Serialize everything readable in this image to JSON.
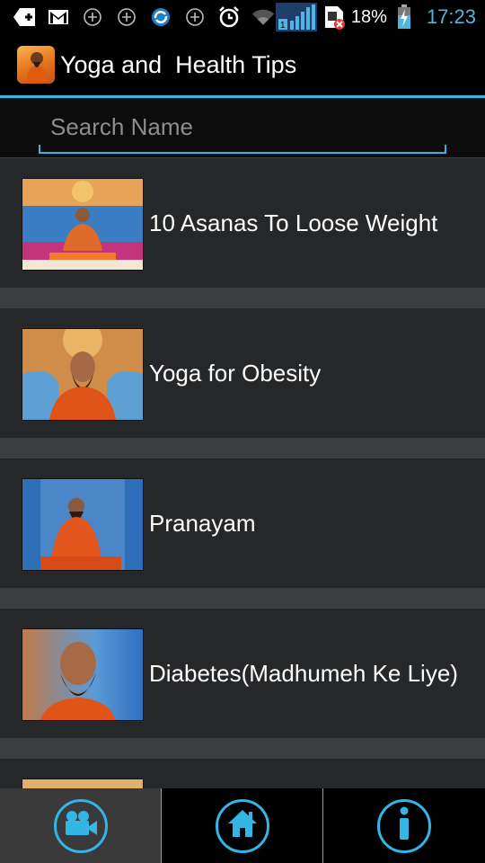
{
  "status_bar": {
    "battery_percent": "18%",
    "time": "17:23",
    "sim_badge": "1",
    "icons": [
      "add-notification-icon",
      "gmail-icon",
      "add-circle-icon",
      "add-circle-icon",
      "sync-icon",
      "add-circle-icon",
      "alarm-icon",
      "wifi-icon",
      "signal-icon",
      "no-sim-icon",
      "battery-charging-icon"
    ]
  },
  "action_bar": {
    "title": "Yoga and  Health Tips",
    "accent_color": "#33b5e5"
  },
  "search": {
    "placeholder": "Search Name",
    "value": ""
  },
  "list": {
    "items": [
      {
        "label": "10 Asanas To Loose Weight"
      },
      {
        "label": "Yoga for Obesity"
      },
      {
        "label": "Pranayam"
      },
      {
        "label": "Diabetes(Madhumeh Ke Liye)"
      },
      {
        "label": ""
      }
    ]
  },
  "bottom_nav": {
    "tabs": [
      {
        "icon": "video-camera-icon",
        "selected": true
      },
      {
        "icon": "home-icon",
        "selected": false
      },
      {
        "icon": "info-icon",
        "selected": false
      }
    ]
  }
}
